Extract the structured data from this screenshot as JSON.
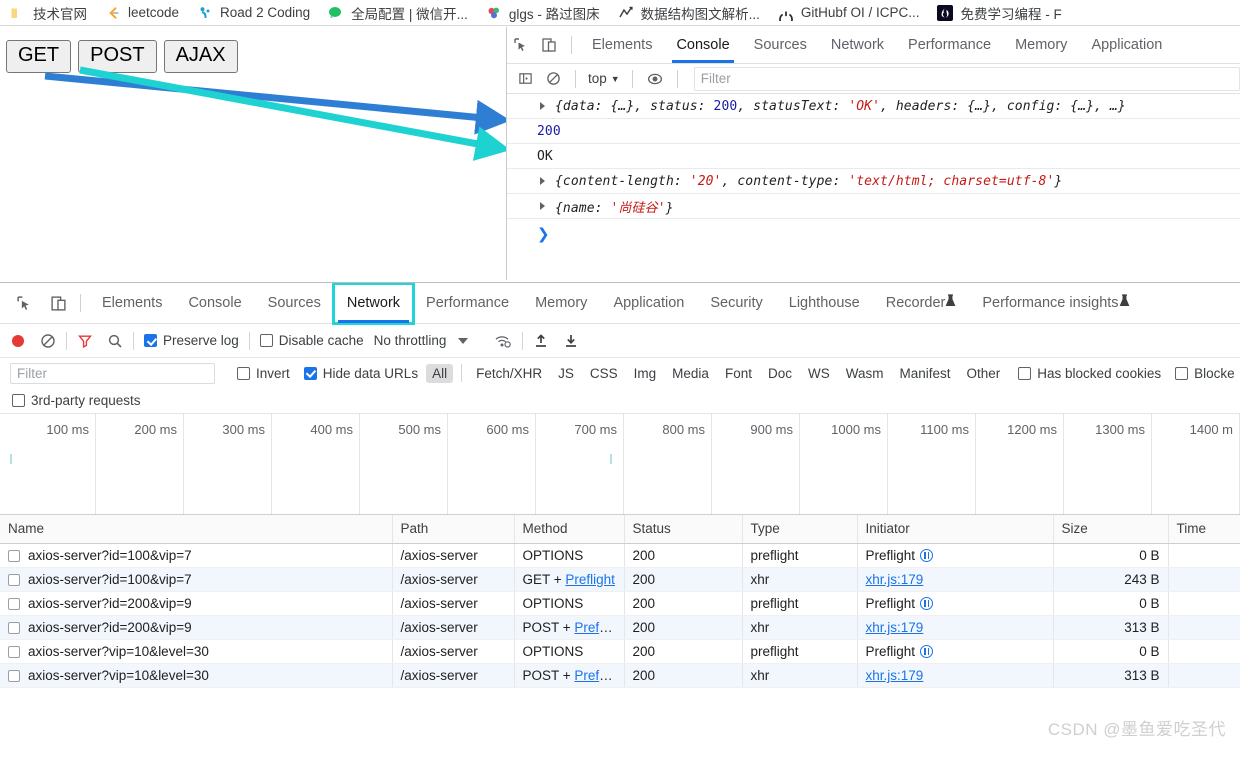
{
  "bookmarks": [
    {
      "label": "技术官网",
      "icon": "folder-icon",
      "color": "#f7d87c"
    },
    {
      "label": "leetcode",
      "icon": "leetcode-icon",
      "color": "#ffa116"
    },
    {
      "label": "Road 2 Coding",
      "icon": "r2c-icon",
      "color": "#1e9fd6"
    },
    {
      "label": "全局配置 | 微信开...",
      "icon": "wechat-icon",
      "color": "#21c063"
    },
    {
      "label": "glgs - 路过图床",
      "icon": "imgbed-icon",
      "color": "#7a5cd6"
    },
    {
      "label": "数据结构图文解析...",
      "icon": "chart-icon",
      "color": "#3a3a3a"
    },
    {
      "label": "GitHubf OI / ICPC...",
      "icon": "github-icon",
      "color": "#24292f"
    },
    {
      "label": "免费学习编程 - F",
      "icon": "freecodecamp-icon",
      "color": "#0a0a23"
    }
  ],
  "page": {
    "buttons": [
      {
        "label": "GET"
      },
      {
        "label": "POST"
      },
      {
        "label": "AJAX"
      }
    ]
  },
  "console": {
    "tabs": [
      {
        "label": "Elements",
        "active": false
      },
      {
        "label": "Console",
        "active": true
      },
      {
        "label": "Sources",
        "active": false
      },
      {
        "label": "Network",
        "active": false
      },
      {
        "label": "Performance",
        "active": false
      },
      {
        "label": "Memory",
        "active": false
      },
      {
        "label": "Application",
        "active": false
      }
    ],
    "toolbar": {
      "context": "top",
      "filter_placeholder": "Filter"
    },
    "rows": [
      {
        "expandable": true,
        "kind": "object",
        "text": "{data: {…}, status: 200, statusText: 'OK', headers: {…}, config: {…}, …}"
      },
      {
        "expandable": false,
        "kind": "number",
        "text": "200"
      },
      {
        "expandable": false,
        "kind": "plain",
        "text": "OK"
      },
      {
        "expandable": true,
        "kind": "object",
        "text": "{content-length: '20', content-type: 'text/html; charset=utf-8'}"
      },
      {
        "expandable": true,
        "kind": "object",
        "text": "{name: '尚硅谷'}"
      }
    ],
    "prompt": "❯"
  },
  "network": {
    "tabs": [
      {
        "label": "Elements",
        "active": false,
        "flask": false,
        "boxed": false
      },
      {
        "label": "Console",
        "active": false,
        "flask": false,
        "boxed": false
      },
      {
        "label": "Sources",
        "active": false,
        "flask": false,
        "boxed": false
      },
      {
        "label": "Network",
        "active": true,
        "flask": false,
        "boxed": true
      },
      {
        "label": "Performance",
        "active": false,
        "flask": false,
        "boxed": false
      },
      {
        "label": "Memory",
        "active": false,
        "flask": false,
        "boxed": false
      },
      {
        "label": "Application",
        "active": false,
        "flask": false,
        "boxed": false
      },
      {
        "label": "Security",
        "active": false,
        "flask": false,
        "boxed": false
      },
      {
        "label": "Lighthouse",
        "active": false,
        "flask": false,
        "boxed": false
      },
      {
        "label": "Recorder",
        "active": false,
        "flask": true,
        "boxed": false
      },
      {
        "label": "Performance insights",
        "active": false,
        "flask": true,
        "boxed": false
      }
    ],
    "toolbar": {
      "preserve_log_label": "Preserve log",
      "preserve_log_checked": true,
      "disable_cache_label": "Disable cache",
      "disable_cache_checked": false,
      "throttling_label": "No throttling",
      "record_active": true,
      "filter_active": true
    },
    "filters": {
      "filter_placeholder": "Filter",
      "invert_label": "Invert",
      "invert_checked": false,
      "hide_data_urls_label": "Hide data URLs",
      "hide_data_urls_checked": true,
      "types": [
        "All",
        "Fetch/XHR",
        "JS",
        "CSS",
        "Img",
        "Media",
        "Font",
        "Doc",
        "WS",
        "Wasm",
        "Manifest",
        "Other"
      ],
      "selected_type": "All",
      "has_blocked_cookies_label": "Has blocked cookies",
      "has_blocked_cookies_checked": false,
      "blocked_label": "Blocke",
      "blocked_checked": false,
      "third_party_label": "3rd-party requests",
      "third_party_checked": false
    },
    "timeline": {
      "ticks": [
        "100 ms",
        "200 ms",
        "300 ms",
        "400 ms",
        "500 ms",
        "600 ms",
        "700 ms",
        "800 ms",
        "900 ms",
        "1000 ms",
        "1100 ms",
        "1200 ms",
        "1300 ms",
        "1400 m"
      ]
    },
    "columns": [
      "Name",
      "Path",
      "Method",
      "Status",
      "Type",
      "Initiator",
      "Size",
      "Time"
    ],
    "requests": [
      {
        "name": "axios-server?id=100&vip=7",
        "path": "/axios-server",
        "method": "OPTIONS",
        "method_link": "",
        "status": "200",
        "type": "preflight",
        "initiator": "Preflight",
        "initiator_link": false,
        "initiator_icon": true,
        "size": "0 B",
        "time": ""
      },
      {
        "name": "axios-server?id=100&vip=7",
        "path": "/axios-server",
        "method": "GET + ",
        "method_link": "Preflight",
        "status": "200",
        "type": "xhr",
        "initiator": "xhr.js:179",
        "initiator_link": true,
        "initiator_icon": false,
        "size": "243 B",
        "time": ""
      },
      {
        "name": "axios-server?id=200&vip=9",
        "path": "/axios-server",
        "method": "OPTIONS",
        "method_link": "",
        "status": "200",
        "type": "preflight",
        "initiator": "Preflight",
        "initiator_link": false,
        "initiator_icon": true,
        "size": "0 B",
        "time": ""
      },
      {
        "name": "axios-server?id=200&vip=9",
        "path": "/axios-server",
        "method": "POST + ",
        "method_link": "Prefli...",
        "status": "200",
        "type": "xhr",
        "initiator": "xhr.js:179",
        "initiator_link": true,
        "initiator_icon": false,
        "size": "313 B",
        "time": ""
      },
      {
        "name": "axios-server?vip=10&level=30",
        "path": "/axios-server",
        "method": "OPTIONS",
        "method_link": "",
        "status": "200",
        "type": "preflight",
        "initiator": "Preflight",
        "initiator_link": false,
        "initiator_icon": true,
        "size": "0 B",
        "time": ""
      },
      {
        "name": "axios-server?vip=10&level=30",
        "path": "/axios-server",
        "method": "POST + ",
        "method_link": "Prefli...",
        "status": "200",
        "type": "xhr",
        "initiator": "xhr.js:179",
        "initiator_link": true,
        "initiator_icon": false,
        "size": "313 B",
        "time": ""
      }
    ]
  },
  "watermark": "CSDN @墨鱼爱吃圣代",
  "colors": {
    "accent": "#1a73e8",
    "highlight": "#1fd6d6",
    "arrow_blue": "#2e7fd4",
    "arrow_cyan": "#1fd2d2",
    "record_red": "#e53935"
  }
}
